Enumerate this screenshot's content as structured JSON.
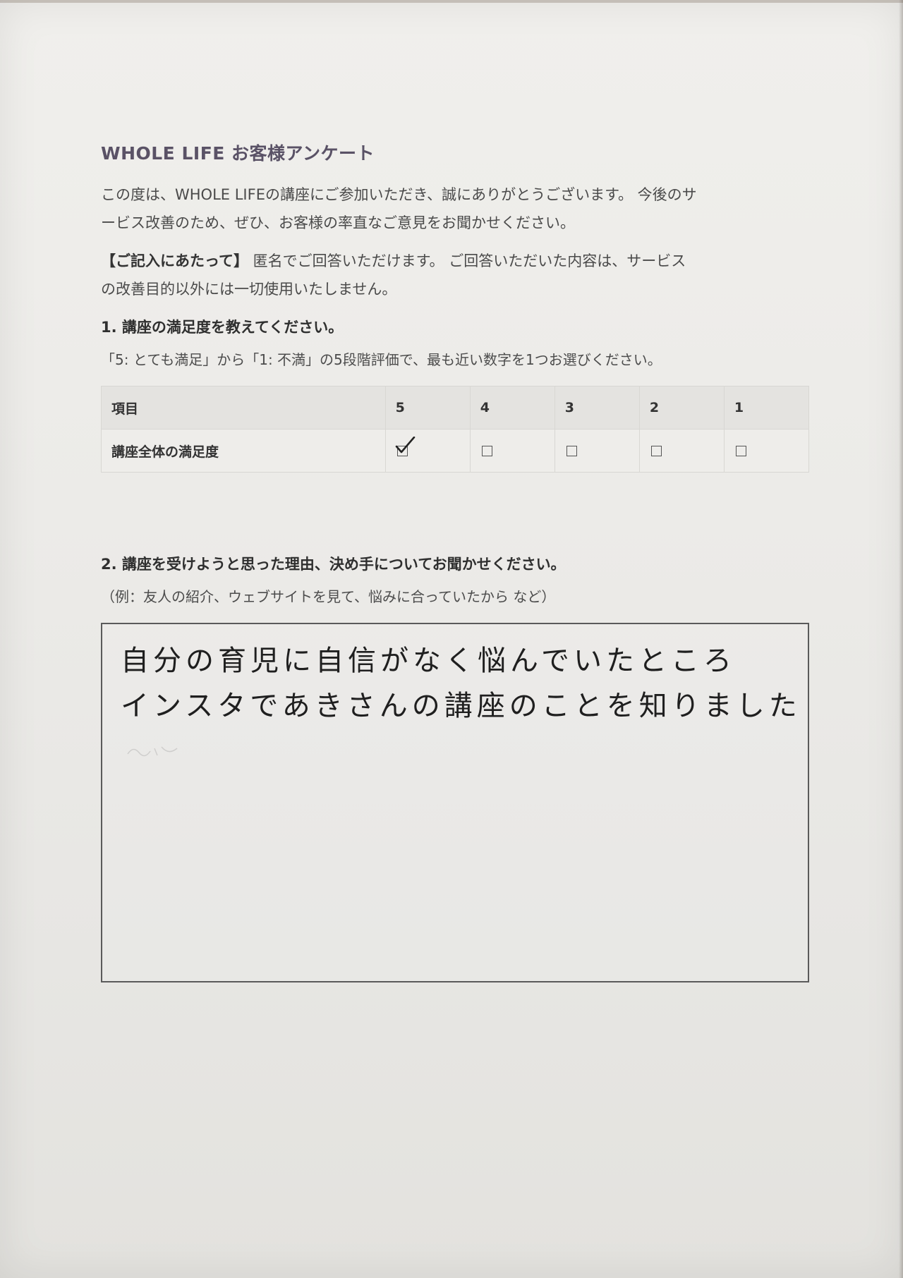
{
  "title": "WHOLE LIFE お客様アンケート",
  "intro": {
    "line1": "この度は、WHOLE LIFEの講座にご参加いただき、誠にありがとうございます。 今後のサ",
    "line2": "ービス改善のため、ぜひ、お客様の率直なご意見をお聞かせください。"
  },
  "notice": {
    "lead": "【ご記入にあたって】",
    "line1_rest": " 匿名でご回答いただけます。 ご回答いただいた内容は、サービス",
    "line2": "の改善目的以外には一切使用いたしません。"
  },
  "question1": {
    "title": "1. 講座の満足度を教えてください。",
    "note": "「5: とても満足」から「1: 不満」の5段階評価で、最も近い数字を1つお選びください。",
    "table": {
      "header_item": "項目",
      "scores": [
        "5",
        "4",
        "3",
        "2",
        "1"
      ],
      "row_label": "講座全体の満足度",
      "selected_score": "5"
    }
  },
  "question2": {
    "title": "2. 講座を受けようと思った理由、決め手についてお聞かせください。",
    "note": "（例：友人の紹介、ウェブサイトを見て、悩みに合っていたから など）",
    "answer_line1": "自分の育児に自信がなく悩んでいたところ",
    "answer_line2": "インスタであきさんの講座のことを知りました"
  }
}
